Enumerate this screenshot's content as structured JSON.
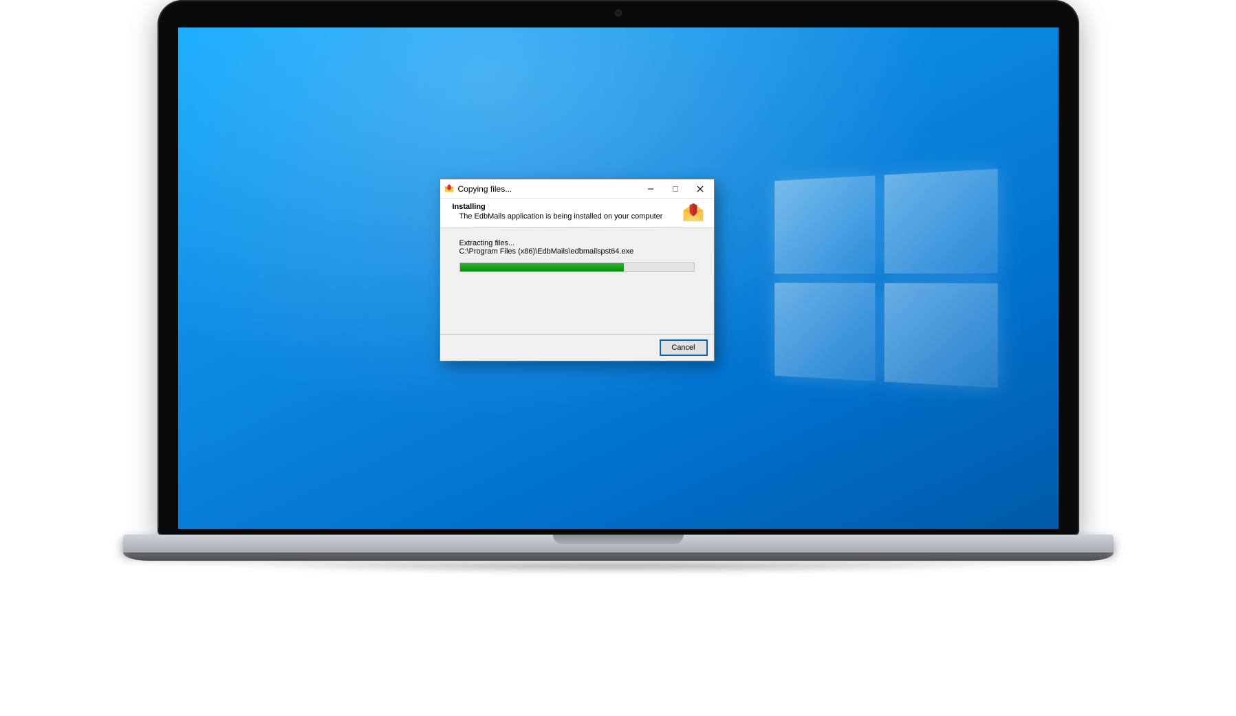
{
  "dialog": {
    "window_title": "Copying files...",
    "header_title": "Installing",
    "header_subtitle": "The EdbMails application is being installed on your computer",
    "status_line": "Extracting files...",
    "path_line": "C:\\Program Files (x86)\\EdbMails\\edbmailspst64.exe",
    "progress_percent": 70,
    "cancel_label": "Cancel"
  },
  "icons": {
    "app_icon": "edbmails-app-icon",
    "header_icon": "envelope-shield-icon",
    "minimize": "minimize-icon",
    "maximize": "maximize-icon",
    "close": "close-icon"
  },
  "colors": {
    "desktop_blue": "#0e8ce4",
    "progress_green": "#1aa31a",
    "button_border": "#0a64a4"
  }
}
